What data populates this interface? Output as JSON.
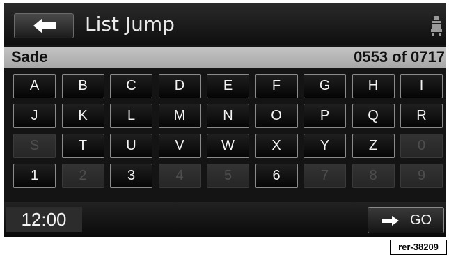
{
  "header": {
    "title": "List Jump",
    "back_icon": "left-arrow-icon",
    "seat_icon": "seat-icon"
  },
  "selection": {
    "name": "Sade",
    "count": "0553 of 0717"
  },
  "keypad": {
    "keys": [
      {
        "label": "A",
        "enabled": true
      },
      {
        "label": "B",
        "enabled": true
      },
      {
        "label": "C",
        "enabled": true
      },
      {
        "label": "D",
        "enabled": true
      },
      {
        "label": "E",
        "enabled": true
      },
      {
        "label": "F",
        "enabled": true
      },
      {
        "label": "G",
        "enabled": true
      },
      {
        "label": "H",
        "enabled": true
      },
      {
        "label": "I",
        "enabled": true
      },
      {
        "label": "J",
        "enabled": true
      },
      {
        "label": "K",
        "enabled": true
      },
      {
        "label": "L",
        "enabled": true
      },
      {
        "label": "M",
        "enabled": true
      },
      {
        "label": "N",
        "enabled": true
      },
      {
        "label": "O",
        "enabled": true
      },
      {
        "label": "P",
        "enabled": true
      },
      {
        "label": "Q",
        "enabled": true
      },
      {
        "label": "R",
        "enabled": true
      },
      {
        "label": "S",
        "enabled": false
      },
      {
        "label": "T",
        "enabled": true
      },
      {
        "label": "U",
        "enabled": true
      },
      {
        "label": "V",
        "enabled": true
      },
      {
        "label": "W",
        "enabled": true
      },
      {
        "label": "X",
        "enabled": true
      },
      {
        "label": "Y",
        "enabled": true
      },
      {
        "label": "Z",
        "enabled": true
      },
      {
        "label": "0",
        "enabled": false
      },
      {
        "label": "1",
        "enabled": true
      },
      {
        "label": "2",
        "enabled": false
      },
      {
        "label": "3",
        "enabled": true
      },
      {
        "label": "4",
        "enabled": false
      },
      {
        "label": "5",
        "enabled": false
      },
      {
        "label": "6",
        "enabled": true
      },
      {
        "label": "7",
        "enabled": false
      },
      {
        "label": "8",
        "enabled": false
      },
      {
        "label": "9",
        "enabled": false
      }
    ]
  },
  "footer": {
    "clock": "12:00",
    "go_label": "GO",
    "go_icon": "right-arrow-icon"
  },
  "figure_ref": "rer-38209",
  "colors": {
    "screen_bg": "#141414",
    "selection_bar": "#b8b8b8",
    "key_enabled_text": "#f4f4f4",
    "key_disabled_text": "#4e4e4e"
  }
}
